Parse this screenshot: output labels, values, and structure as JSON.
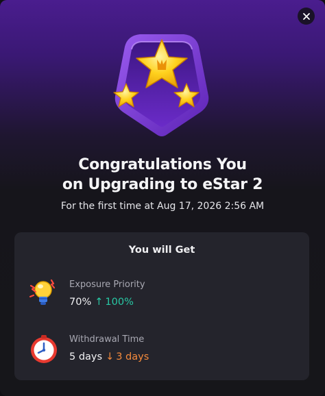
{
  "dialog": {
    "title_line1": "Congratulations You",
    "title_line2": "on Upgrading to eStar 2",
    "subtitle": "For the first time at Aug 17, 2026 2:56 AM"
  },
  "benefits_card": {
    "title": "You will Get",
    "items": [
      {
        "icon": "lightbulb-icon",
        "label": "Exposure Priority",
        "from_value": "70%",
        "to_value": "100%",
        "direction": "up",
        "color": "#28c9a5"
      },
      {
        "icon": "clock-icon",
        "label": "Withdrawal Time",
        "from_value": "5 days",
        "to_value": "3 days",
        "direction": "down",
        "color": "#f58a3c"
      }
    ]
  },
  "colors": {
    "header_purple": "#4a1d8e",
    "background": "#16161a",
    "card": "#24242c",
    "increase": "#28c9a5",
    "decrease": "#f58a3c"
  },
  "icons": {
    "close": "close-icon",
    "badge": "estar-shield-badge-icon"
  }
}
